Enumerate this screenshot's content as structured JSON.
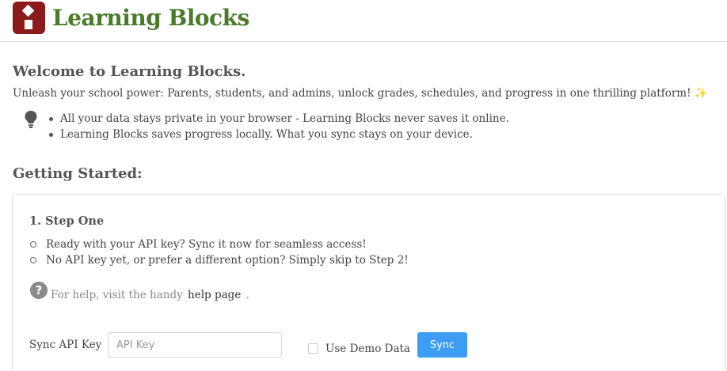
{
  "header": {
    "brand": "Learning Blocks",
    "brand_color": "#4a7a2a",
    "logo_color": "#8b1a1a"
  },
  "welcome": {
    "title": "Welcome to Learning Blocks.",
    "subtitle": "Unleash your school power: Parents, students, and admins, unlock grades, schedules, and progress in one thrilling platform!",
    "sparkle": "✨",
    "tip_icon": "lightbulb-icon",
    "bullets": [
      "All your data stays private in your browser - Learning Blocks never saves it online.",
      "Learning Blocks saves progress locally. What you sync stays on your device."
    ]
  },
  "getting_started": {
    "title": "Getting Started:",
    "step": {
      "title": "1. Step One",
      "items": [
        "Ready with your API key? Sync it now for seamless access!",
        "No API key yet, or prefer a different option? Simply skip to Step 2!"
      ],
      "help_icon": "question-circle-icon",
      "help_prefix": "For help, visit the handy",
      "help_link": "help page",
      "help_suffix": ".",
      "api_label": "Sync API Key",
      "api_placeholder": "API Key",
      "api_value": "",
      "demo_label": "Use Demo Data",
      "demo_checked": false,
      "sync_label": "Sync",
      "sync_color": "#3d9cf3"
    }
  }
}
